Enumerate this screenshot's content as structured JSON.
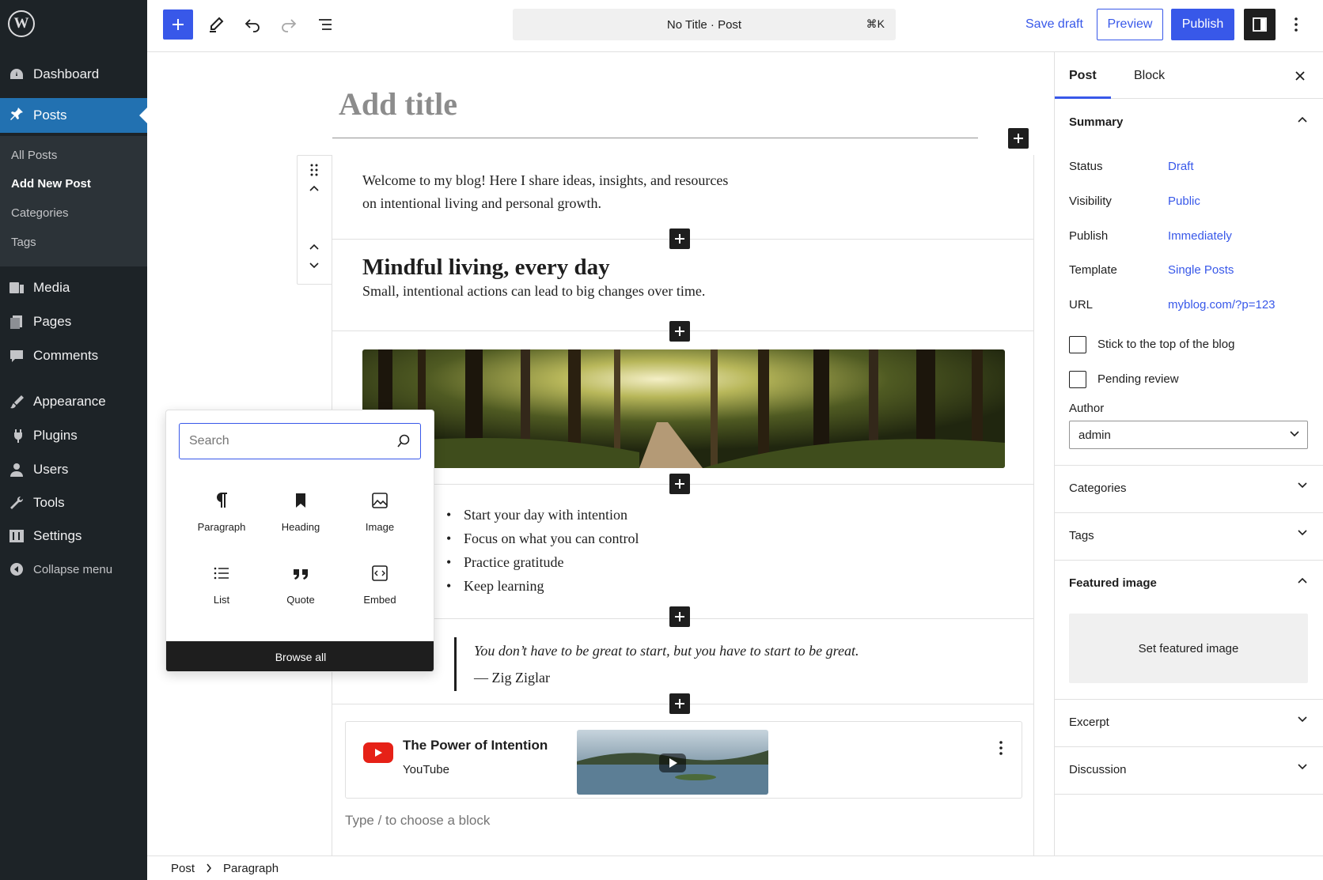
{
  "admin_menu": {
    "items": [
      {
        "label": "Dashboard",
        "icon": "dashboard-icon"
      },
      {
        "label": "Posts",
        "icon": "pushpin-icon"
      },
      {
        "label": "Media",
        "icon": "media-icon"
      },
      {
        "label": "Pages",
        "icon": "pages-icon"
      },
      {
        "label": "Comments",
        "icon": "comments-icon"
      },
      {
        "label": "Appearance",
        "icon": "brush-icon"
      },
      {
        "label": "Plugins",
        "icon": "plugin-icon"
      },
      {
        "label": "Users",
        "icon": "user-icon"
      },
      {
        "label": "Tools",
        "icon": "wrench-icon"
      },
      {
        "label": "Settings",
        "icon": "settings-icon"
      }
    ],
    "submenu": [
      "All Posts",
      "Add New Post",
      "Categories",
      "Tags"
    ],
    "collapse": "Collapse menu"
  },
  "toolbar": {
    "document_title": "No Title · Post",
    "shortcut": "⌘K",
    "save_draft": "Save draft",
    "preview": "Preview",
    "publish": "Publish"
  },
  "editor": {
    "title_placeholder": "Add title",
    "intro": [
      "Welcome to my blog! Here I share ideas, insights, and resources",
      "on intentional living and personal growth."
    ],
    "heading": "Mindful living, every day",
    "subtext": "Small, intentional actions can lead to big changes over time.",
    "list_items": [
      "Start your day with intention",
      "Focus on what you can control",
      "Practice gratitude",
      "Keep learning"
    ],
    "quote": "You don’t have to be great to start, but you have to start to be great.",
    "citation": "— Zig Ziglar",
    "embed": {
      "title": "The Power of Intention",
      "provider": "YouTube"
    },
    "placeholder": "Type / to choose a block"
  },
  "inserter": {
    "search_placeholder": "Search",
    "blocks": [
      {
        "label": "Paragraph",
        "icon": "paragraph-icon"
      },
      {
        "label": "Heading",
        "icon": "bookmark-icon"
      },
      {
        "label": "Image",
        "icon": "image-icon"
      },
      {
        "label": "List",
        "icon": "list-icon"
      },
      {
        "label": "Quote",
        "icon": "quote-icon"
      },
      {
        "label": "Embed",
        "icon": "embed-icon"
      }
    ],
    "browse_all": "Browse all"
  },
  "settings": {
    "tabs": [
      "Post",
      "Block"
    ],
    "summary": {
      "title": "Summary",
      "rows": [
        {
          "label": "Status",
          "value": "Draft"
        },
        {
          "label": "Visibility",
          "value": "Public"
        },
        {
          "label": "Publish",
          "value": "Immediately"
        },
        {
          "label": "Template",
          "value": "Single Posts"
        },
        {
          "label": "URL",
          "value": "myblog.com/?p=123"
        }
      ],
      "sticky": "Stick to the top of the blog",
      "pending": "Pending review",
      "author_label": "Author",
      "author_value": "admin"
    },
    "categories": "Categories",
    "tags": "Tags",
    "featured_image": "Featured image",
    "set_featured": "Set featured image",
    "excerpt": "Excerpt",
    "discussion": "Discussion"
  },
  "breadcrumb": [
    "Post",
    "Paragraph"
  ],
  "colors": {
    "accent": "#3858e9",
    "admin_bg": "#1d2327",
    "active_menu": "#2271b1"
  }
}
